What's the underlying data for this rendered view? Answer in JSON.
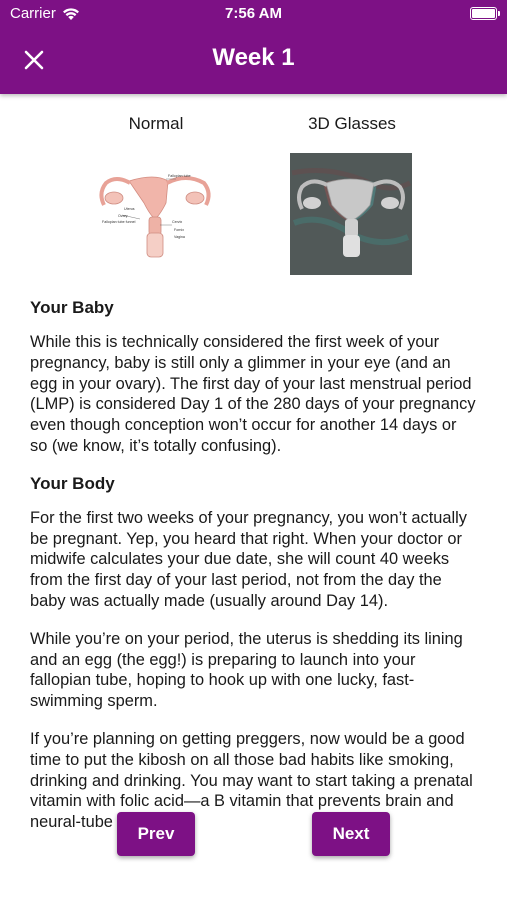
{
  "status_bar": {
    "carrier": "Carrier",
    "time": "7:56 AM"
  },
  "header": {
    "title": "Week 1",
    "close_icon": "close-icon"
  },
  "images": {
    "normal_label": "Normal",
    "threed_label": "3D Glasses",
    "diagram_labels": [
      "Fallopian tube",
      "Uterus",
      "Ovary",
      "Fallopian tube funnel",
      "Cervix",
      "Fornix",
      "Vagina"
    ]
  },
  "sections": {
    "baby": {
      "heading": "Your Baby",
      "paragraph": "While this is technically considered the first week of your pregnancy, baby is still only a glimmer in your eye (and an egg in your ovary). The first day of your last menstrual period (LMP) is considered Day 1 of the 280 days of your pregnancy even though conception won’t occur for another 14 days or so (we know, it’s totally confusing)."
    },
    "body": {
      "heading": "Your Body",
      "paragraphs": [
        "For the first two weeks of your pregnancy, you won’t actually be pregnant. Yep, you heard that right. When your doctor or midwife calculates your due date, she will count 40 weeks from the first day of your last period, not from the day the baby was actually made (usually around Day 14).",
        "While you’re on your period, the uterus is shedding its lining and an egg (the egg!) is preparing to launch into your fallopian tube, hoping to hook up with one lucky, fast-swimming sperm.",
        "If you’re planning on getting preggers, now would be a good time to put the kibosh on all those bad habits like smoking, drinking and drinking. You may want to start taking a prenatal vitamin with folic acid—a B vitamin that prevents brain and neural-tube birth"
      ]
    }
  },
  "buttons": {
    "prev": "Prev",
    "next": "Next"
  },
  "colors": {
    "brand": "#7d1185"
  }
}
